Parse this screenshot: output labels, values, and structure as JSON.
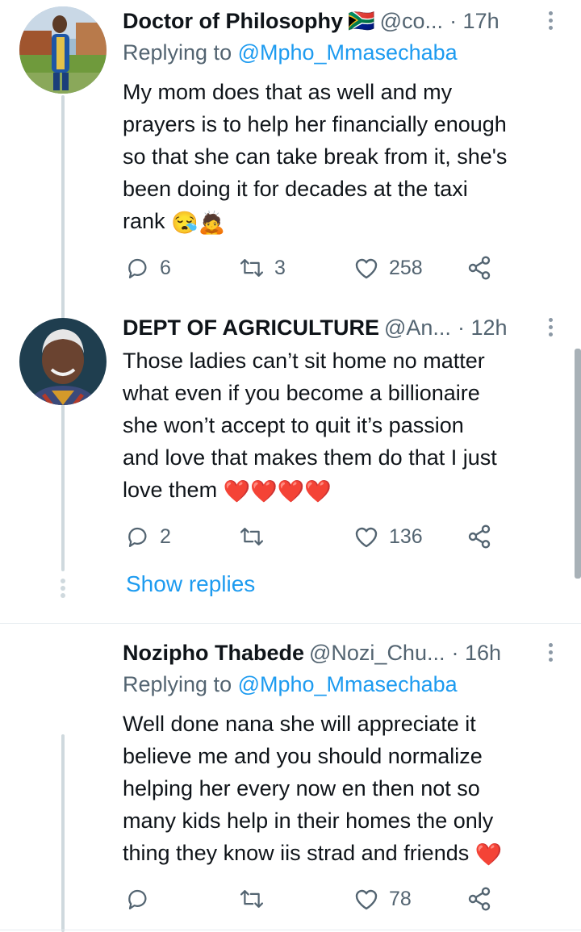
{
  "tweets": [
    {
      "name": "Doctor of Philosophy",
      "flag": "🇿🇦",
      "handle": "@co...",
      "time": "· 17h",
      "replying_label": "Replying to ",
      "replying_to": "@Mpho_Mmasechaba",
      "lines": [
        "My mom does that as well and my",
        "prayers is to help her financially enough",
        "so that she can take break from it, she's",
        "been doing it for decades at the taxi",
        "rank"
      ],
      "emoji": "😪🙇",
      "replies": "6",
      "retweets": "3",
      "likes": "258"
    },
    {
      "name": "DEPT OF AGRICULTURE",
      "handle": "@An...",
      "time": "· 12h",
      "lines": [
        "Those ladies can’t sit home no matter",
        "what even if you become a billionaire",
        "she won’t accept to quit it’s passion",
        "and love that makes them do that I just",
        "love them"
      ],
      "emoji": "❤️❤️❤️❤️",
      "replies": "2",
      "retweets": "",
      "likes": "136",
      "show_replies": "Show replies"
    },
    {
      "name": "Nozipho Thabede",
      "handle": "@Nozi_Chu...",
      "time": "· 16h",
      "replying_label": "Replying to ",
      "replying_to": "@Mpho_Mmasechaba",
      "lines": [
        "Well done nana she will appreciate it",
        "believe me and you should normalize",
        "helping her every now en then not so",
        "many kids help in their homes the only",
        "thing they know iis strad and friends"
      ],
      "emoji": "❤️",
      "replies": "",
      "retweets": "",
      "likes": "78"
    }
  ],
  "colors": {
    "link": "#1d9bf0",
    "secondary": "#536471",
    "thread": "#cfd9de"
  },
  "icons": [
    "reply-icon",
    "retweet-icon",
    "like-icon",
    "share-icon",
    "more-icon"
  ]
}
